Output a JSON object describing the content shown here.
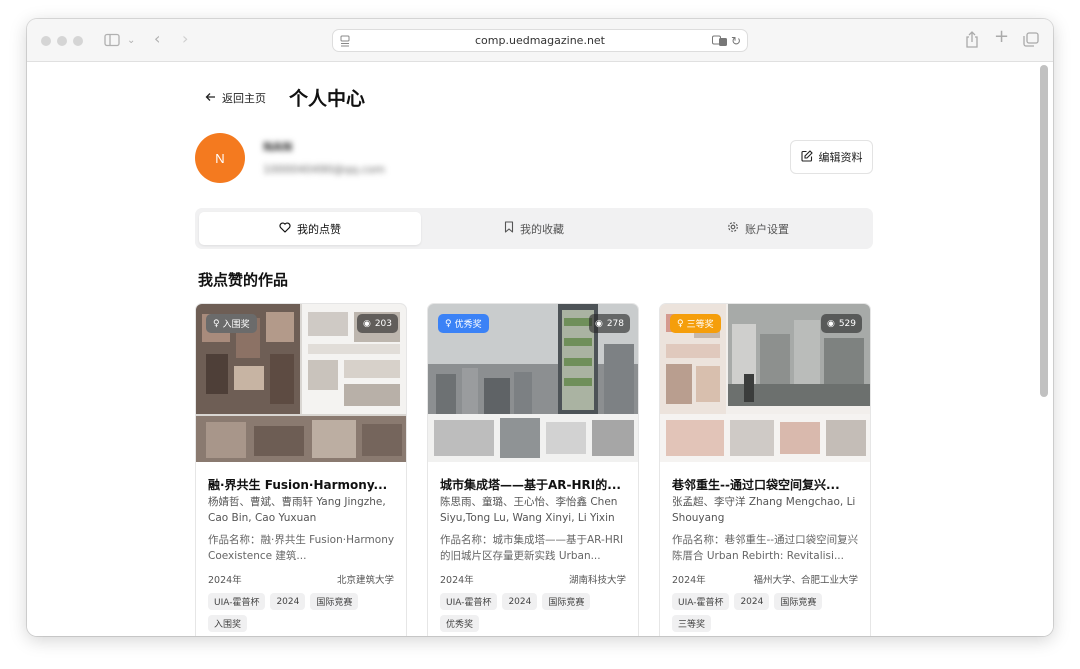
{
  "browser": {
    "url": "comp.uedmagazine.net"
  },
  "header": {
    "back_label": "返回主页",
    "page_title": "个人中心"
  },
  "profile": {
    "avatar_initial": "N",
    "name": "NAN",
    "email": "1000040490@qq.com",
    "edit_label": "编辑资料"
  },
  "tabs": [
    {
      "label": "我的点赞",
      "icon": "heart-icon",
      "active": true
    },
    {
      "label": "我的收藏",
      "icon": "bookmark-icon",
      "active": false
    },
    {
      "label": "账户设置",
      "icon": "gear-icon",
      "active": false
    }
  ],
  "section_title": "我点赞的作品",
  "cards": [
    {
      "badge": "入围奖",
      "badge_color": "#6b6b6b",
      "views": "203",
      "title": "融·界共生 Fusion·Harmony...",
      "authors": "杨婧哲、曹斌、曹雨轩 Yang Jingzhe, Cao Bin, Cao Yuxuan",
      "work": "作品名称：融·界共生 Fusion·Harmony Coexistence 建筑...",
      "year": "2024年",
      "school": "北京建筑大学",
      "tags": [
        "UIA-霍普杯",
        "2024",
        "国际竞赛",
        "入围奖"
      ]
    },
    {
      "badge": "优秀奖",
      "badge_color": "#3b82f6",
      "views": "278",
      "title": "城市集成塔——基于AR-HRI的...",
      "authors": "陈思雨、童璐、王心怡、李怡鑫 Chen Siyu,Tong Lu, Wang Xinyi, Li Yixin",
      "work": "作品名称：城市集成塔——基于AR-HRI的旧城片区存量更新实践 Urban...",
      "year": "2024年",
      "school": "湖南科技大学",
      "tags": [
        "UIA-霍普杯",
        "2024",
        "国际竞赛",
        "优秀奖"
      ]
    },
    {
      "badge": "三等奖",
      "badge_color": "#f59e0b",
      "views": "529",
      "title": "巷邻重生--通过口袋空间复兴...",
      "authors": "张孟超、李守洋 Zhang Mengchao, Li Shouyang",
      "work": "作品名称：巷邻重生--通过口袋空间复兴陈厝合 Urban Rebirth: Revitalisi...",
      "year": "2024年",
      "school": "福州大学、合肥工业大学",
      "tags": [
        "UIA-霍普杯",
        "2024",
        "国际竞赛",
        "三等奖"
      ]
    }
  ]
}
